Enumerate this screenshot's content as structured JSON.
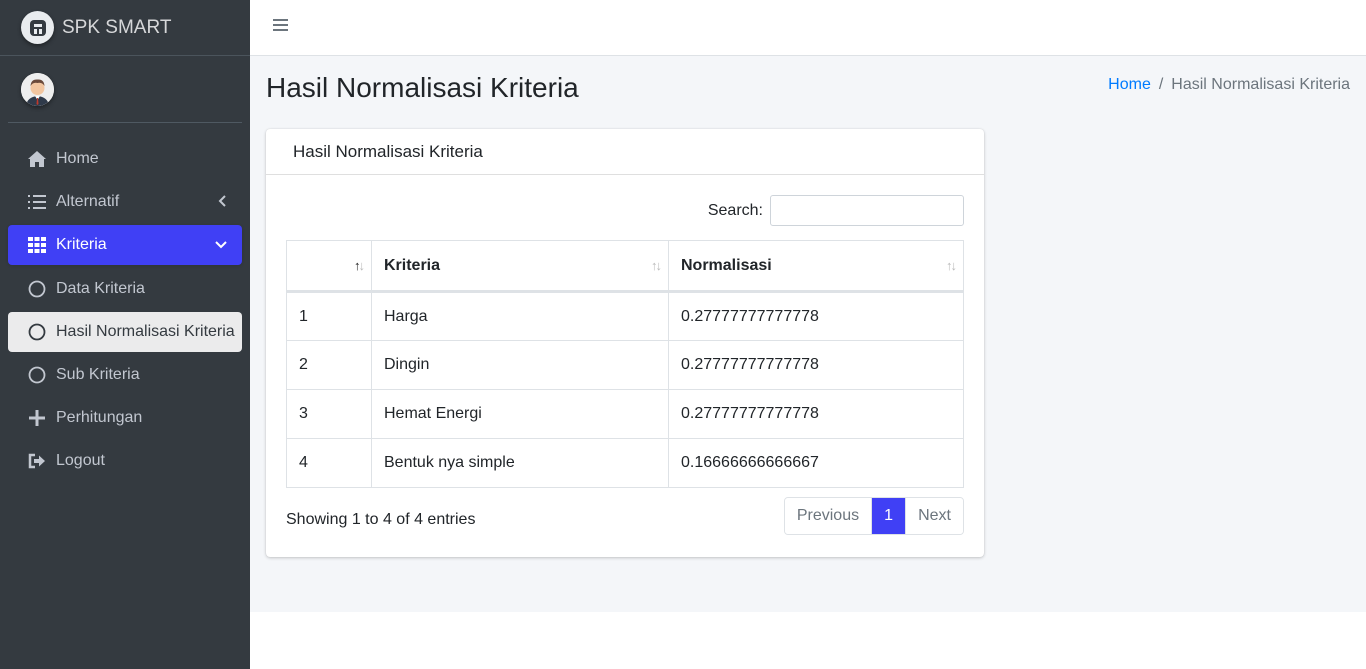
{
  "brand": {
    "name": "SPK SMART"
  },
  "sidebar": {
    "items": [
      {
        "label": "Home",
        "icon": "home-icon"
      },
      {
        "label": "Alternatif",
        "icon": "list-icon"
      },
      {
        "label": "Kriteria",
        "icon": "grid-icon"
      },
      {
        "label": "Data Kriteria",
        "icon": "circle-icon"
      },
      {
        "label": "Hasil Normalisasi Kriteria",
        "icon": "circle-icon"
      },
      {
        "label": "Sub Kriteria",
        "icon": "circle-icon"
      },
      {
        "label": "Perhitungan",
        "icon": "plus-icon"
      },
      {
        "label": "Logout",
        "icon": "logout-icon"
      }
    ]
  },
  "page": {
    "title": "Hasil Normalisasi Kriteria"
  },
  "breadcrumb": {
    "home": "Home",
    "separator": "/",
    "current": "Hasil Normalisasi Kriteria"
  },
  "card": {
    "title": "Hasil Normalisasi Kriteria"
  },
  "search": {
    "label": "Search:",
    "value": ""
  },
  "table": {
    "headers": [
      "",
      "Kriteria",
      "Normalisasi"
    ],
    "rows": [
      [
        "1",
        "Harga",
        "0.27777777777778"
      ],
      [
        "2",
        "Dingin",
        "0.27777777777778"
      ],
      [
        "3",
        "Hemat Energi",
        "0.27777777777778"
      ],
      [
        "4",
        "Bentuk nya simple",
        "0.16666666666667"
      ]
    ]
  },
  "info": "Showing 1 to 4 of 4 entries",
  "pagination": {
    "previous": "Previous",
    "current": "1",
    "next": "Next"
  },
  "colors": {
    "accent": "#4040f5",
    "sidebar_bg": "#343a40",
    "content_bg": "#f4f6f9"
  }
}
